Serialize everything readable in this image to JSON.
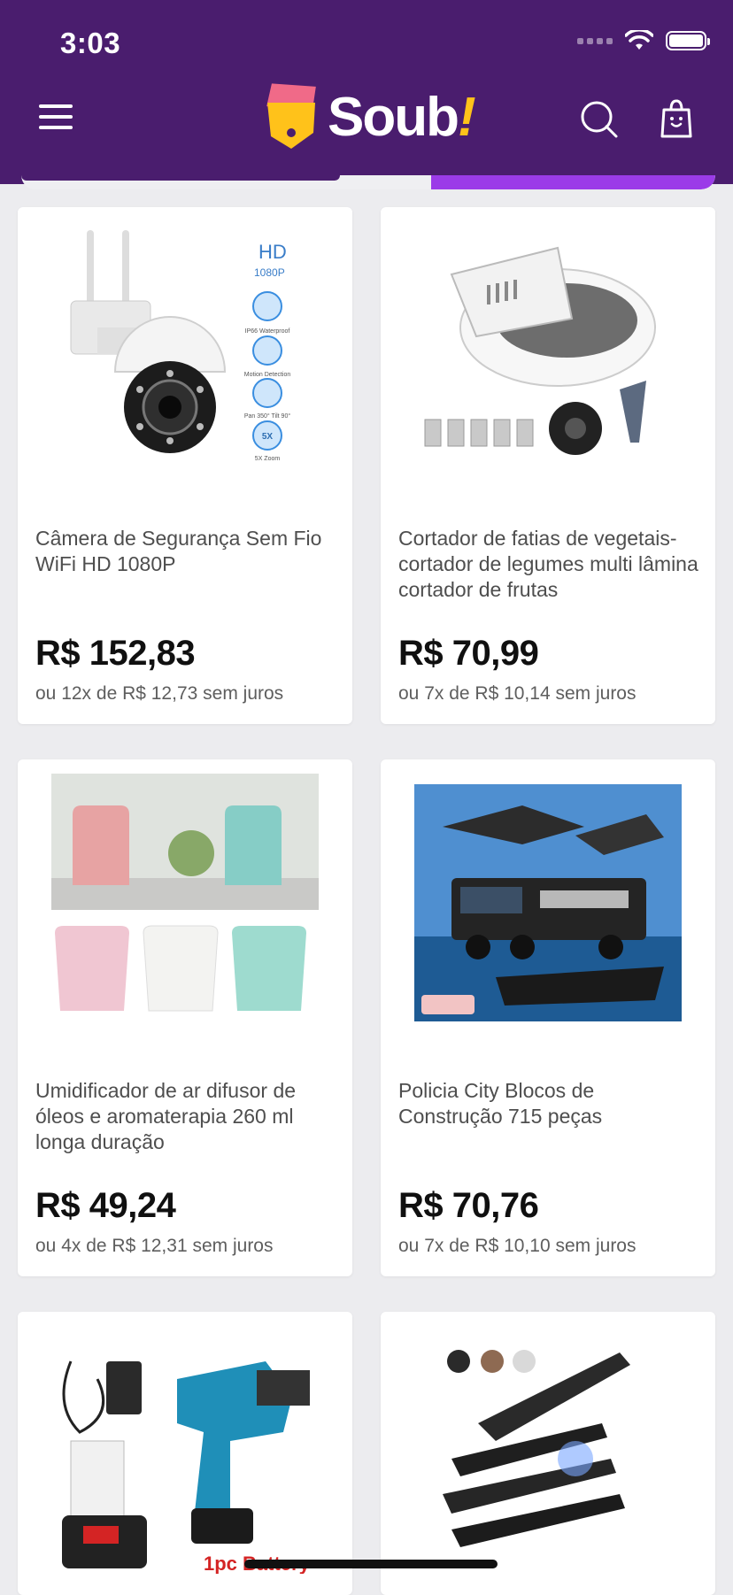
{
  "status_bar": {
    "time": "3:03"
  },
  "header": {
    "logo_text": "Soub",
    "logo_mark": "!",
    "menu_icon": "hamburger-menu-icon",
    "search_icon": "search-icon",
    "cart_icon": "shopping-bag-icon"
  },
  "category_progress": {
    "value": 0.41
  },
  "colors": {
    "header_bg": "#4a1d6e",
    "accent": "#9b3be8",
    "logo_yellow": "#ffc21a",
    "logo_pink": "#f06a88"
  },
  "products": [
    {
      "name": "Câmera de Segurança Sem Fio WiFi HD 1080P",
      "price": "R$ 152,83",
      "installments": "ou 12x de R$ 12,73 sem juros",
      "img_labels": {
        "hd": "HD",
        "res": "1080P",
        "f1": "IP66 Waterproof",
        "f2": "Motion Detection",
        "f3": "Pan 350° Tilt 90°",
        "f4": "5X Zoom",
        "zoom": "5X"
      }
    },
    {
      "name": "Cortador de fatias de vegetais-cortador de legumes multi lâmina cortador de frutas",
      "price": "R$ 70,99",
      "installments": "ou 7x de R$ 10,14 sem juros"
    },
    {
      "name": "Umidificador de ar difusor de óleos e aromaterapia 260 ml longa duração",
      "price": "R$ 49,24",
      "installments": "ou 4x de R$ 12,31 sem juros"
    },
    {
      "name": "Policia City Blocos de Construção 715 peças",
      "price": "R$ 70,76",
      "installments": "ou 7x de R$ 10,10 sem juros"
    },
    {
      "name": "",
      "price": "",
      "installments": "",
      "img_labels": {
        "battery": "1pc Battery"
      }
    },
    {
      "name": "",
      "price": "",
      "installments": ""
    }
  ]
}
